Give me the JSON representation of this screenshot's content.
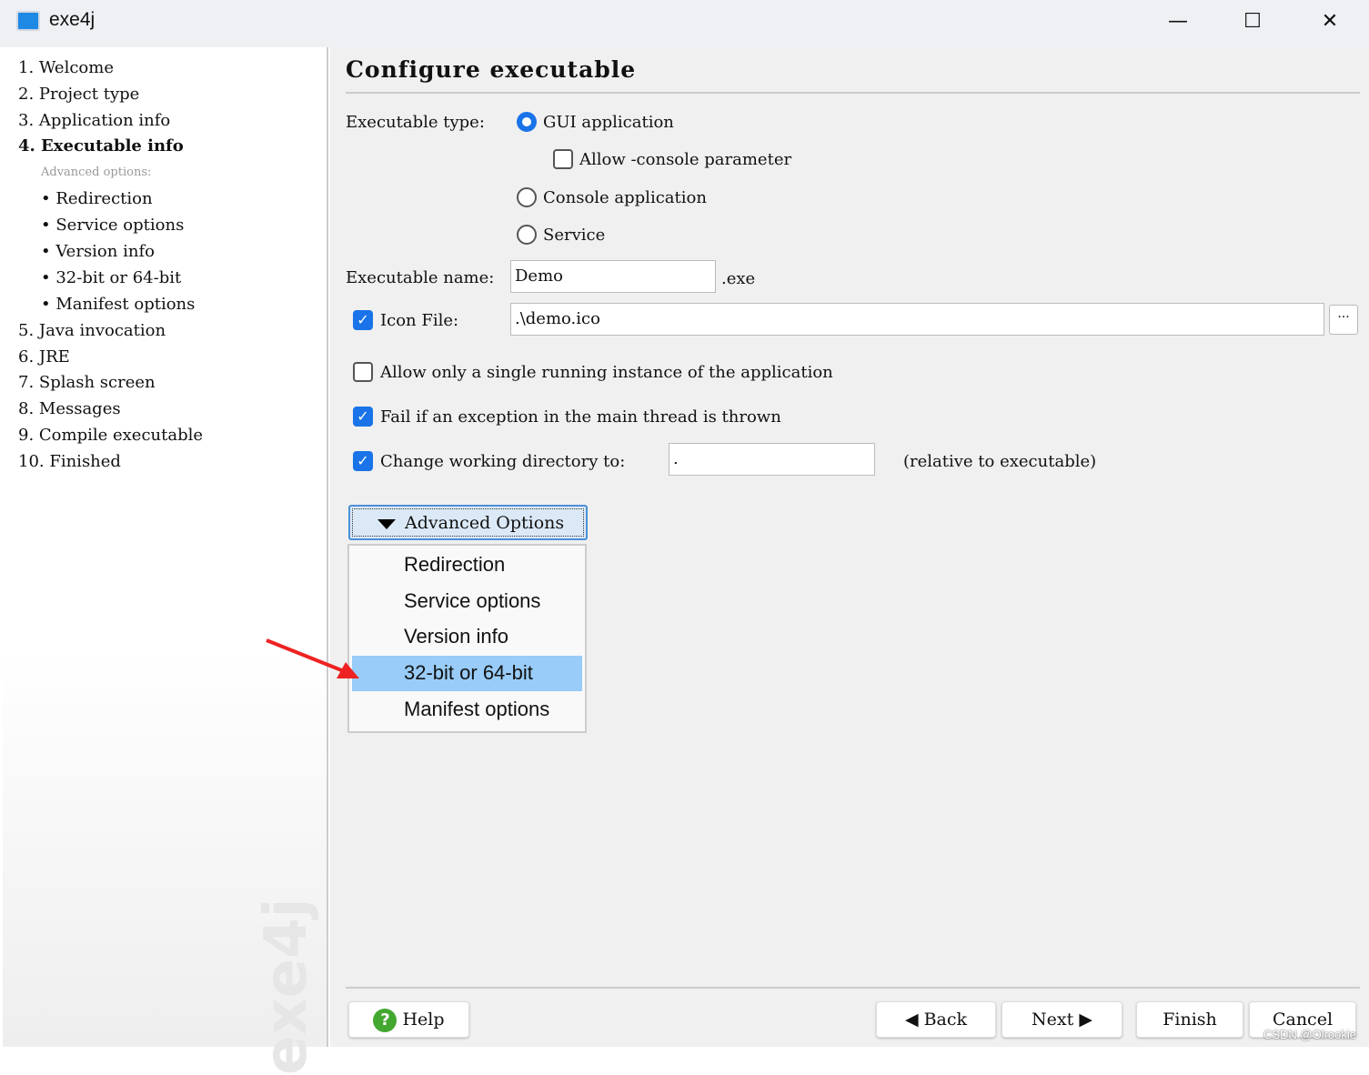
{
  "window": {
    "title": "exe4j",
    "minimize": "—",
    "maximize": "☐",
    "close": "✕"
  },
  "sidebar": {
    "items": [
      {
        "label": "1.  Welcome"
      },
      {
        "label": "2.  Project type"
      },
      {
        "label": "3.  Application info"
      },
      {
        "label": "4.  Executable info"
      },
      {
        "label": "Advanced options:"
      },
      {
        "label": "•  Redirection"
      },
      {
        "label": "•  Service options"
      },
      {
        "label": "•  Version info"
      },
      {
        "label": "•  32-bit or 64-bit"
      },
      {
        "label": "•  Manifest options"
      },
      {
        "label": "5.  Java invocation"
      },
      {
        "label": "6.  JRE"
      },
      {
        "label": "7.  Splash screen"
      },
      {
        "label": "8.  Messages"
      },
      {
        "label": "9.  Compile executable"
      },
      {
        "label": "10.  Finished"
      }
    ],
    "watermark": "exe4j"
  },
  "main": {
    "title": "Configure executable",
    "exe_type_label": "Executable type:",
    "gui_app": "GUI application",
    "gui_selected": true,
    "allow_console": "Allow -console parameter",
    "allow_console_checked": false,
    "console_app": "Console application",
    "service": "Service",
    "exe_name_label": "Executable name:",
    "exe_name_value": "Demo",
    "exe_suffix": ".exe",
    "icon_file_label": "Icon File:",
    "icon_file_checked": true,
    "icon_file_value": ".\\demo.ico",
    "browse": "···",
    "single_instance": "Allow only a single running instance of the application",
    "single_instance_checked": false,
    "fail_exception": "Fail if an exception in the main thread is thrown",
    "fail_exception_checked": true,
    "change_dir": "Change working directory to:",
    "change_dir_checked": true,
    "change_dir_value": ".",
    "relative": "(relative to executable)",
    "advanced_button": "Advanced Options",
    "advanced_menu": [
      "Redirection",
      "Service options",
      "Version info",
      "32-bit or 64-bit",
      "Manifest options"
    ],
    "advanced_menu_selected": "32-bit or 64-bit"
  },
  "footer": {
    "help": "Help",
    "back": "Back",
    "next": "Next",
    "finish": "Finish",
    "cancel": "Cancel",
    "credit": "CSDN @Olrookie"
  },
  "colors": {
    "accent": "#1a73e8",
    "menu_highlight": "#99ccf8",
    "arrow": "#ee2222"
  }
}
